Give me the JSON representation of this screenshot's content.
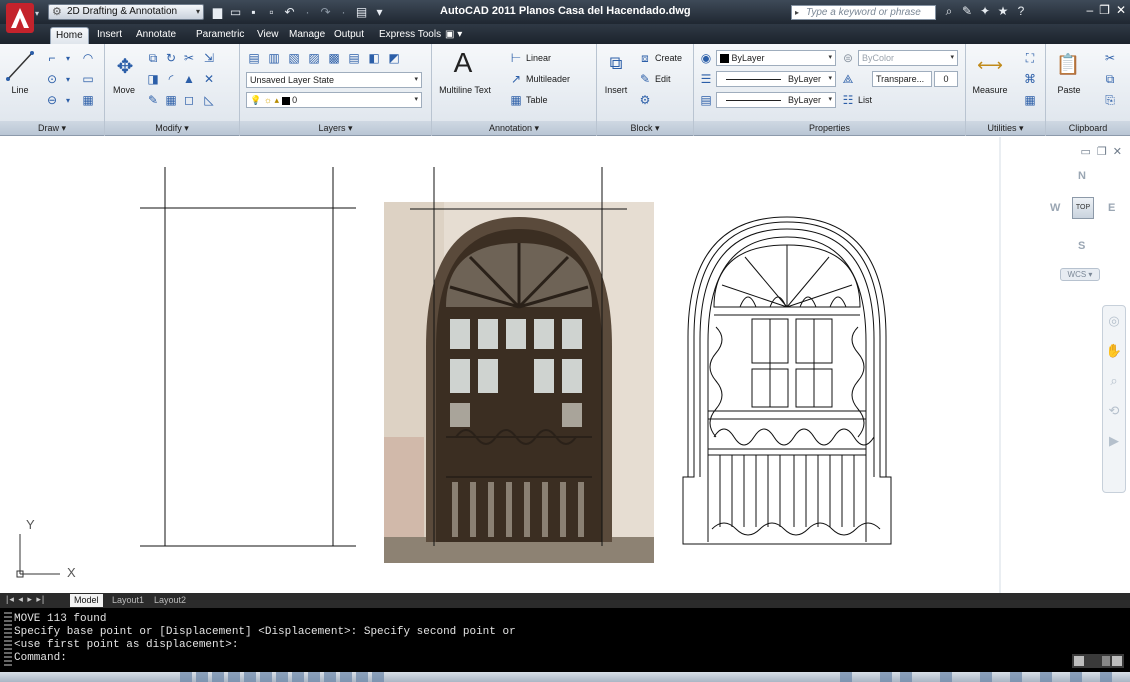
{
  "titlebar": {
    "workspace": "2D Drafting & Annotation",
    "title": "AutoCAD 2011   Planos Casa del Hacendado.dwg",
    "search_placeholder": "Type a keyword or phrase"
  },
  "tabs": [
    "Home",
    "Insert",
    "Annotate",
    "Parametric",
    "View",
    "Manage",
    "Output",
    "Express Tools"
  ],
  "ribbon": {
    "draw": {
      "label": "Draw",
      "line": "Line"
    },
    "modify": {
      "label": "Modify",
      "move": "Move"
    },
    "layers": {
      "label": "Layers",
      "layer_state": "Unsaved Layer State",
      "current_layer": "0"
    },
    "annotation": {
      "label": "Annotation",
      "multiline_text": "Multiline Text",
      "linear": "Linear",
      "multileader": "Multileader",
      "table": "Table"
    },
    "block": {
      "label": "Block",
      "insert": "Insert",
      "create": "Create",
      "edit": "Edit"
    },
    "properties": {
      "label": "Properties",
      "color": "ByLayer",
      "bycolor": "ByColor",
      "linetype": "ByLayer",
      "lineweight": "ByLayer",
      "transparency": "Transpare...",
      "transparency_value": "0",
      "list": "List"
    },
    "utilities": {
      "label": "Utilities",
      "measure": "Measure"
    },
    "clipboard": {
      "label": "Clipboard",
      "paste": "Paste"
    }
  },
  "viewcube": {
    "north": "N",
    "south": "S",
    "west": "W",
    "east": "E",
    "face": "TOP",
    "wcs": "WCS"
  },
  "ucs": {
    "x": "X",
    "y": "Y"
  },
  "layout_tabs": [
    "Model",
    "Layout1",
    "Layout2"
  ],
  "command_line": {
    "lines": [
      "MOVE 113 found",
      "Specify base point or [Displacement] <Displacement>: Specify second point or",
      "<use first point as displacement>:",
      "Command:"
    ]
  },
  "colors": {
    "title_bar": "#27303b",
    "ribbon_bg": "#e9eef3",
    "canvas_bg": "#ffffff",
    "command_bg": "#000000",
    "photo_wall": "#e6ddd2",
    "photo_door": "#3b2e22"
  }
}
